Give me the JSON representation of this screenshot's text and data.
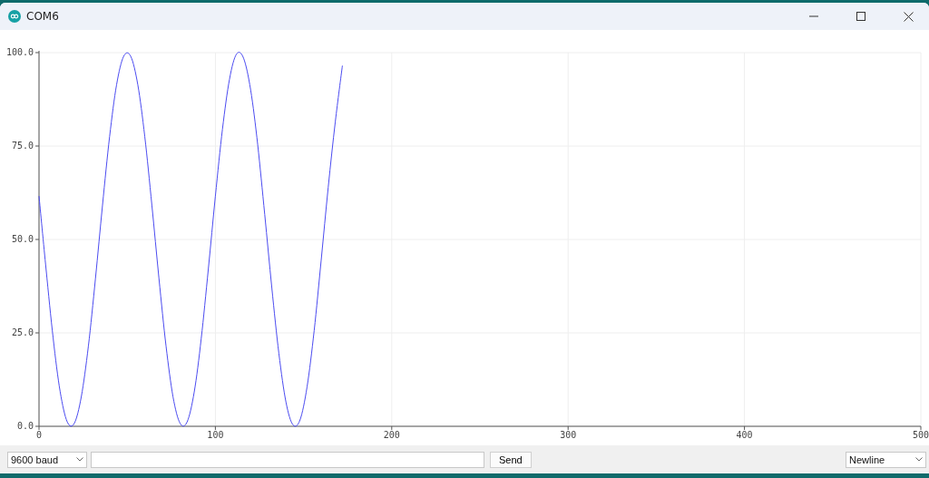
{
  "window": {
    "title": "COM6"
  },
  "plot": {
    "chart_data": {
      "type": "line",
      "grid": true,
      "xlim": [
        0,
        500
      ],
      "ylim": [
        0,
        100
      ],
      "xticks": [
        0,
        100,
        200,
        300,
        400,
        500
      ],
      "yticks": [
        {
          "value": 0,
          "label": "0.0"
        },
        {
          "value": 25,
          "label": "25.0"
        },
        {
          "value": 50,
          "label": "50.0"
        },
        {
          "value": 75,
          "label": "75.0"
        },
        {
          "value": 100,
          "label": "100.0"
        }
      ],
      "x": [
        0,
        4,
        8,
        12,
        16,
        20,
        24,
        28,
        32,
        36,
        40,
        44,
        48,
        52,
        56,
        60,
        64,
        68,
        72,
        76,
        80,
        84,
        88,
        92,
        96,
        100,
        104,
        108,
        112,
        116,
        120,
        124,
        128,
        132,
        136,
        140,
        144,
        148,
        152,
        156,
        160,
        164,
        168,
        172
      ],
      "series": [
        {
          "color": "#4b4bf0",
          "values": [
            61.6,
            42.0,
            23.6,
            9.3,
            1.2,
            0.8,
            8.0,
            21.4,
            39.5,
            59.2,
            77.5,
            91.4,
            99.0,
            99.0,
            91.4,
            77.5,
            59.2,
            39.6,
            21.5,
            7.9,
            0.8,
            1.2,
            9.2,
            23.5,
            42.0,
            61.6,
            79.5,
            92.9,
            99.6,
            98.5,
            90.0,
            75.3,
            56.7,
            37.1,
            19.5,
            6.5,
            0.4,
            1.7,
            10.6,
            25.6,
            44.4,
            64.0,
            81.5,
            96.5
          ]
        }
      ]
    }
  },
  "controls": {
    "baud": {
      "value": "9600 baud"
    },
    "send": "Send",
    "line_ending": {
      "value": "Newline"
    }
  }
}
